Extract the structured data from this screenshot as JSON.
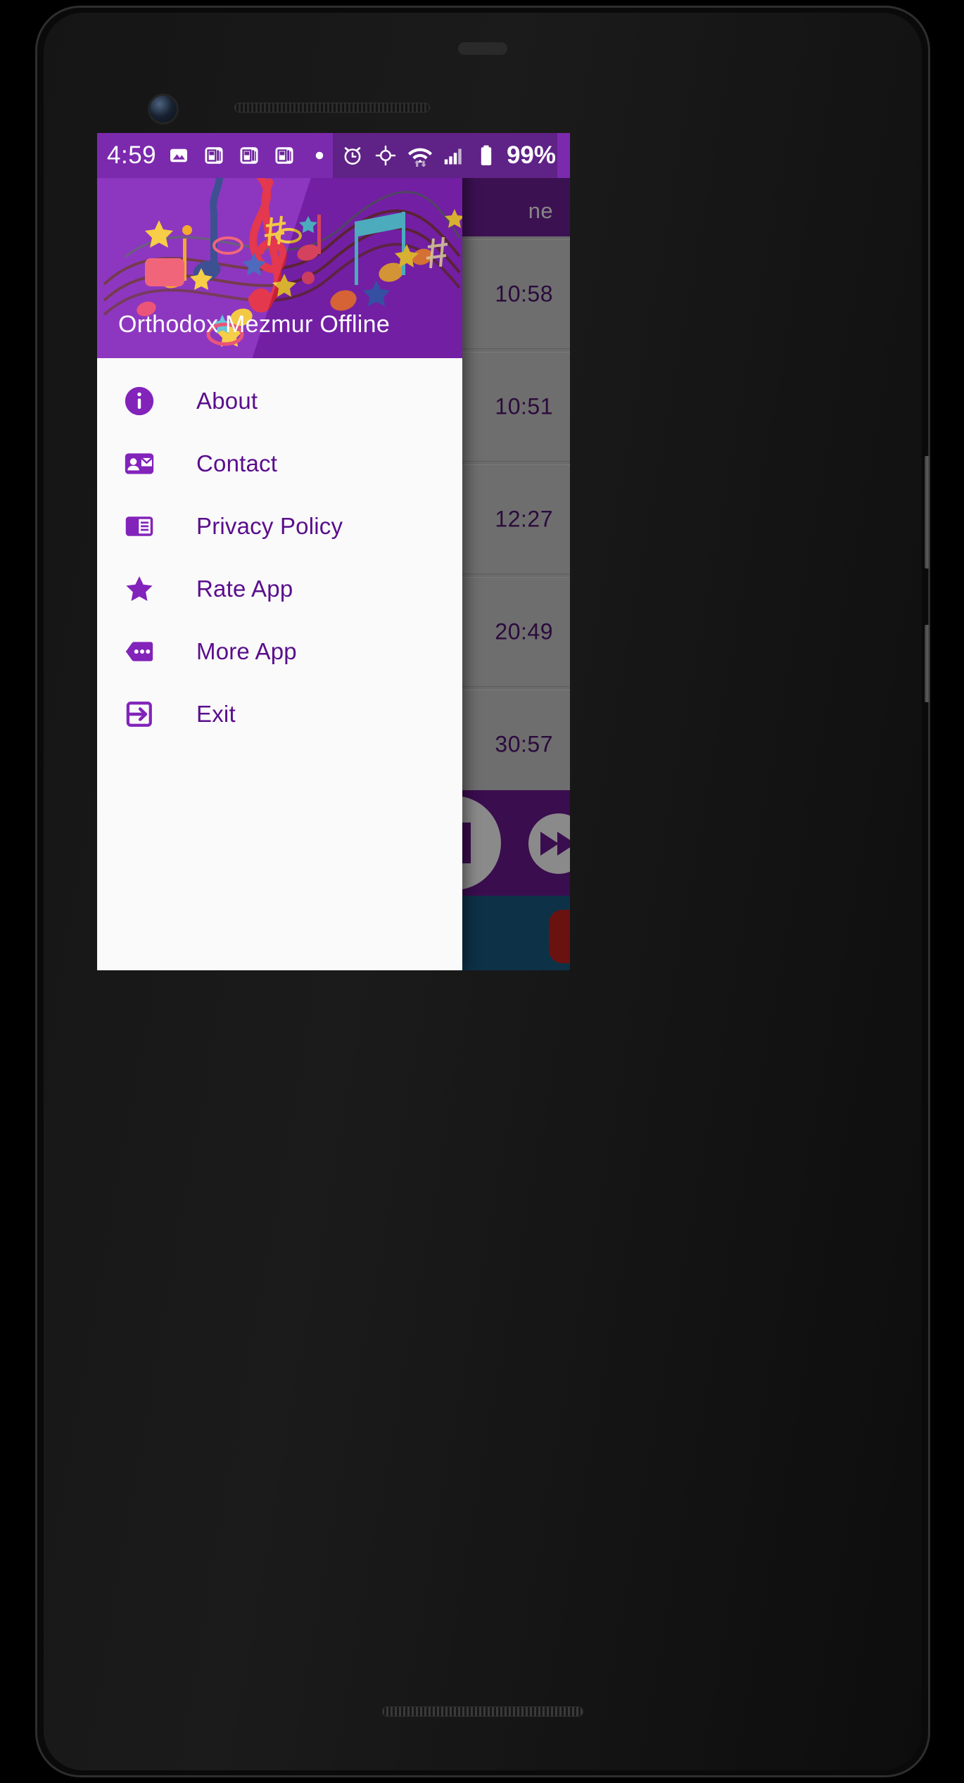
{
  "status_bar": {
    "time": "4:59",
    "battery_percent": "99%",
    "left_icons": [
      "image-icon",
      "news-icon",
      "news-icon",
      "news-icon",
      "dot-icon"
    ],
    "right_icons": [
      "alarm-icon",
      "location-icon",
      "wifi-icon",
      "signal-icon",
      "battery-icon"
    ],
    "background_color": "#7b2aad",
    "right_background_color": "#5f2286"
  },
  "drawer": {
    "header": {
      "title": "Orthodox Mezmur Offline",
      "background_color": "#8223ba",
      "banner_art": "music-notes-banner"
    },
    "items": [
      {
        "label": "About",
        "icon": "info-circle-icon"
      },
      {
        "label": "Contact",
        "icon": "contact-mail-icon"
      },
      {
        "label": "Privacy Policy",
        "icon": "chrome-reader-mode-icon"
      },
      {
        "label": "Rate App",
        "icon": "star-icon"
      },
      {
        "label": "More App",
        "icon": "comment-dots-icon"
      },
      {
        "label": "Exit",
        "icon": "exit-to-app-icon"
      }
    ],
    "label_color": "#5a0e8c",
    "background_color": "#fafafa"
  },
  "background_app": {
    "appbar_title_visible": "ne",
    "appbar_color": "#3c1152",
    "list": [
      {
        "duration": "10:58"
      },
      {
        "duration": "10:51"
      },
      {
        "duration": "12:27"
      },
      {
        "duration": "20:49"
      },
      {
        "duration": "30:57"
      }
    ],
    "player": {
      "pause_button": "pause-icon",
      "next_button": "fast-forward-icon",
      "background_color": "#3a0d4e"
    },
    "youtube_banner": {
      "icon": "youtube-play-icon",
      "background_color": "#0d3147",
      "badge_color": "#6a1210"
    }
  },
  "device": {
    "frame": "phone-frame",
    "camera": "front-camera",
    "earpiece": "earpiece-grille"
  }
}
